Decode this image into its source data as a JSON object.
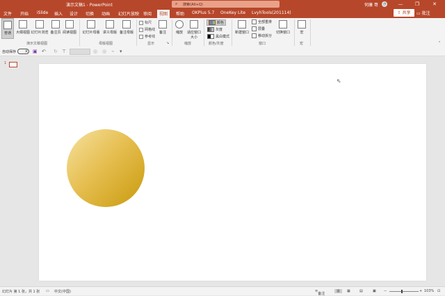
{
  "titlebar": {
    "doc_title": "演示文稿1 - PowerPoint",
    "search_placeholder": "搜索(Alt+Q)",
    "search_icon": "⌕",
    "user_name": "何康 哥",
    "avatar_icon": "◔",
    "minimize": "—",
    "restore": "❐",
    "close": "✕"
  },
  "tabs": [
    "文件",
    "开始",
    "iSlide",
    "插入",
    "设计",
    "切换",
    "动画",
    "幻灯片放映",
    "审阅",
    "视图",
    "帮助",
    "OKPlus 5.7",
    "OneKey Lite",
    "LvyhTools(201114)"
  ],
  "active_tab": "视图",
  "share_label": "共享",
  "comment_label": "批注",
  "ribbon": {
    "pres_views": [
      "普通",
      "大纲视图",
      "幻灯片浏览",
      "备注页",
      "阅读视图"
    ],
    "pres_views_group": "演示文稿视图",
    "master_views": [
      "幻灯片母版",
      "讲义母版",
      "备注母版"
    ],
    "master_views_group": "母版视图",
    "show_items": [
      "标尺",
      "网格线",
      "参考线"
    ],
    "notes_label": "备注",
    "show_group": "显示",
    "zoom_label": "缩放",
    "fit_window_label": "适应窗口大小",
    "zoom_group": "缩放",
    "color_items": [
      "颜色",
      "灰度",
      "黑白模式"
    ],
    "color_group": "颜色/灰度",
    "new_window": "新建窗口",
    "window_items": [
      "全部重排",
      "层叠",
      "移动拆分"
    ],
    "switch_window": "切换窗口",
    "window_group": "窗口",
    "macro_label": "宏",
    "macro_group": "宏"
  },
  "qat": {
    "autosave_label": "自动保存",
    "autosave_state": "关"
  },
  "thumbnail_number": "1",
  "statusbar": {
    "slide_info": "幻灯片 第 1 张，共 1 张",
    "language": "中文(中国)",
    "notes": "备注",
    "zoom": "103%"
  },
  "colors": {
    "accent": "#b7472a",
    "circle_light": "#f6e2a0",
    "circle_dark": "#c99a0c"
  }
}
